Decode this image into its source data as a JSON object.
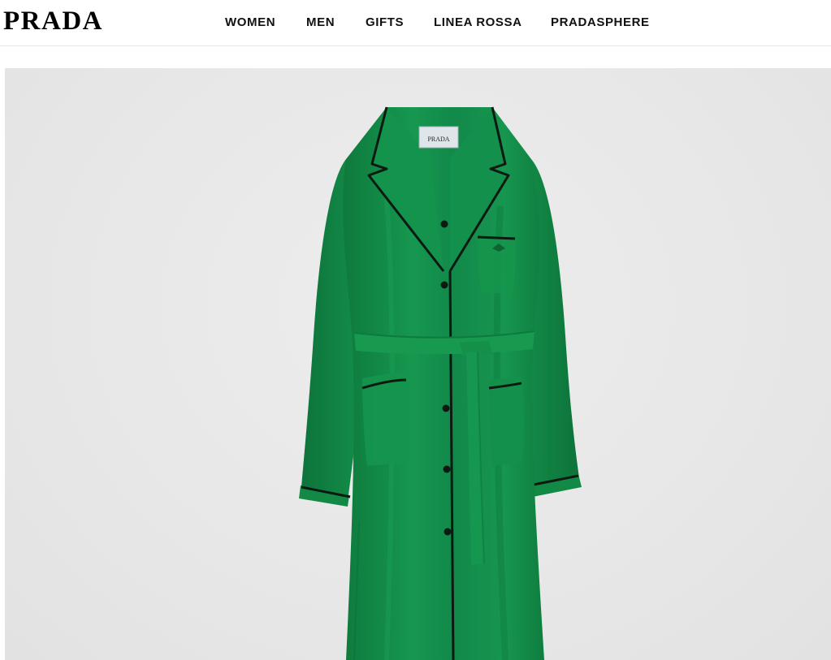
{
  "header": {
    "logo": "PRADA",
    "nav": [
      {
        "label": "WOMEN"
      },
      {
        "label": "MEN"
      },
      {
        "label": "GIFTS"
      },
      {
        "label": "LINEA ROSSA"
      },
      {
        "label": "PRADASPHERE"
      }
    ]
  },
  "product_image": {
    "label_text": "PRADA",
    "garment_color": "#138a47",
    "piping_color": "#0d1a12",
    "background_color": "#e9e9e9"
  }
}
